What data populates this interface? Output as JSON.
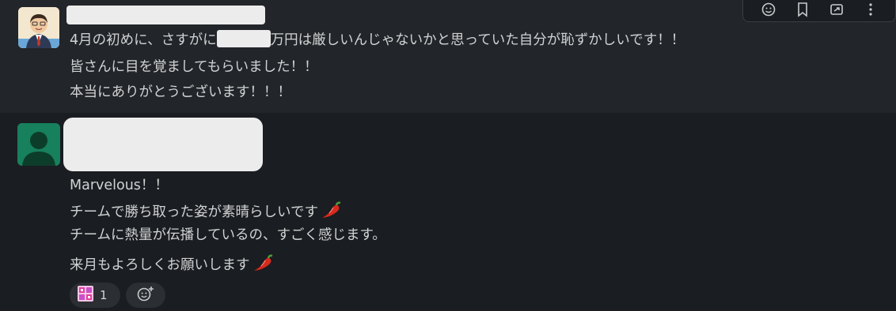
{
  "message1": {
    "lines": [
      "4月の初めに、さすがに",
      "万円は厳しいんじゃないかと思っていた自分が恥ずかしいです！！",
      "皆さんに目を覚ましてもらいました！！",
      "本当にありがとうございます！！！"
    ]
  },
  "message2": {
    "lines": [
      "Marvelous！！",
      "チームで勝ち取った姿が素晴らしいです",
      "チームに熱量が伝播しているの、すごく感じます。",
      "来月もよろしくお願いします"
    ]
  },
  "toolbar": {
    "icons": [
      "emoji-icon",
      "bookmark-icon",
      "share-icon",
      "more-icon"
    ]
  },
  "reactions": [
    {
      "emoji": "congrats-emoji",
      "count": "1",
      "accent": "#e040a0"
    },
    {
      "emoji": "add-reaction-icon",
      "count": ""
    }
  ],
  "colors": {
    "background": "#1a1d21",
    "hover_row": "#222529",
    "text": "#d1d2d3",
    "avatar_green": "#17805c"
  }
}
